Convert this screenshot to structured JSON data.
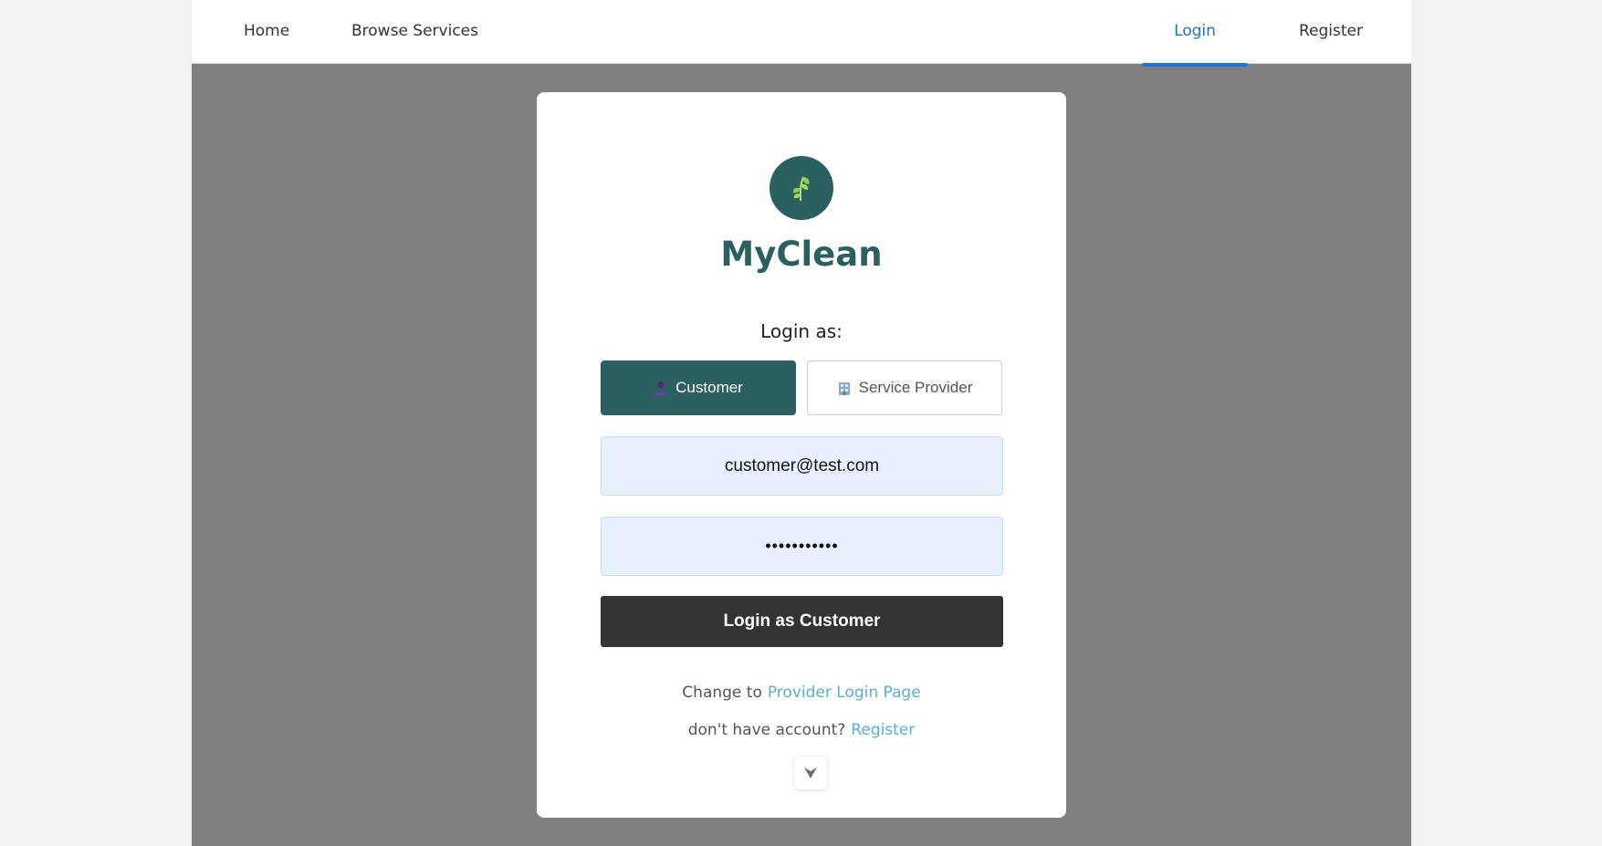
{
  "nav": {
    "home": "Home",
    "browse": "Browse Services",
    "login": "Login",
    "register": "Register",
    "active": "Login",
    "accent_color": "#1a73e8"
  },
  "brand": {
    "logo_icon": "leaf-icon",
    "name": "MyClean",
    "color": "#2c6060"
  },
  "login": {
    "heading": "Login as:",
    "roles": [
      {
        "label": "Customer",
        "icon": "customer-icon",
        "selected": true
      },
      {
        "label": "Service Provider",
        "icon": "building-icon",
        "selected": false
      }
    ],
    "email_value": "customer@test.com",
    "password_value": "•••••••••••",
    "submit_label": "Login as Customer"
  },
  "footer_links": {
    "change_prefix": "Change to",
    "change_link": "Provider Login Page",
    "account_prefix": "don't have account?",
    "account_link": "Register"
  },
  "scroll_button": {
    "icon": "chevron-down-icon"
  }
}
